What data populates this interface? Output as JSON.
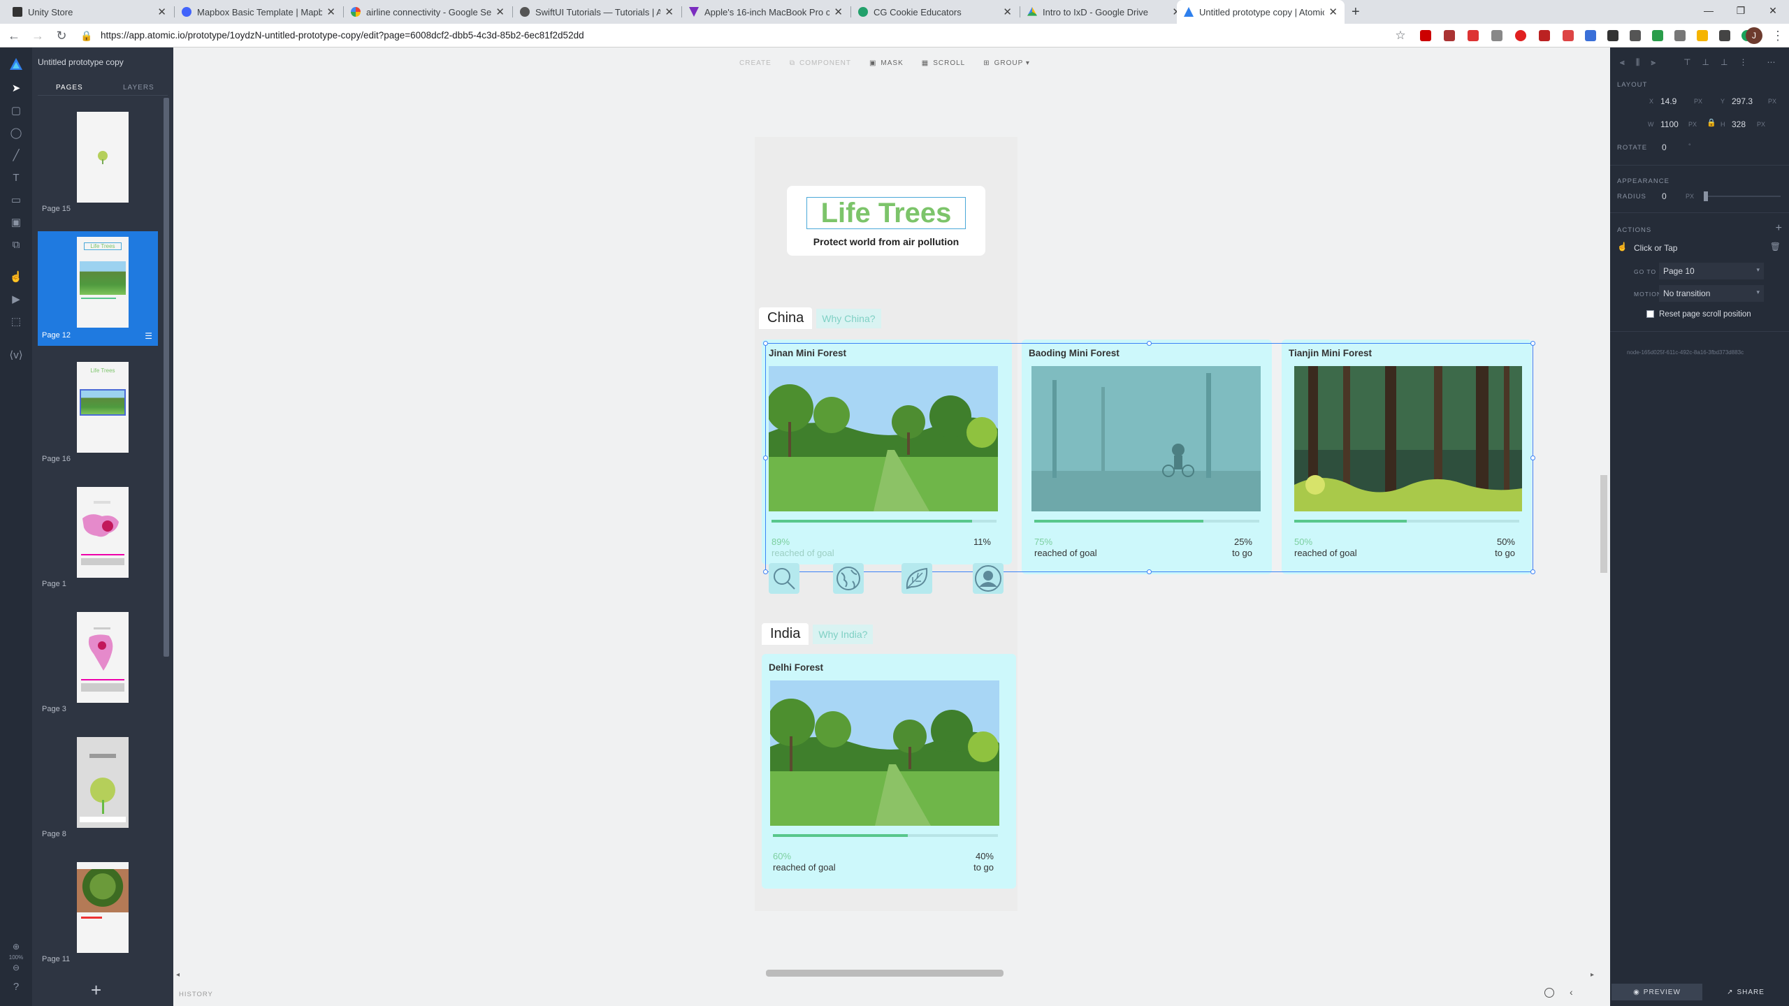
{
  "browser": {
    "tabs": [
      {
        "title": "Unity Store",
        "color": "#333333"
      },
      {
        "title": "Mapbox Basic Template | Mapbo",
        "color": "#4264fb"
      },
      {
        "title": "airline connectivity - Google Sea",
        "color": "#4285f4"
      },
      {
        "title": "SwiftUI Tutorials — Tutorials | Ap",
        "color": "#555555"
      },
      {
        "title": "Apple's 16-inch MacBook Pro co",
        "color": "#7b2cbf"
      },
      {
        "title": "CG Cookie Educators",
        "color": "#22a06b"
      },
      {
        "title": "Intro to IxD - Google Drive",
        "color": "#1a73e8"
      },
      {
        "title": "Untitled prototype copy | Atomic",
        "color": "#2f80ed"
      }
    ],
    "url": "https://app.atomic.io/prototype/1oydzN-untitled-prototype-copy/edit?page=6008dcf2-dbb5-4c3d-85b2-6ec81f2d52dd",
    "new_tab_label": "+",
    "avatar": "J"
  },
  "left_panel": {
    "project_title": "Untitled prototype copy",
    "tabs": {
      "pages": "PAGES",
      "layers": "LAYERS"
    },
    "pages": [
      {
        "name": "Page 15"
      },
      {
        "name": "Page 12",
        "selected": true
      },
      {
        "name": "Page 16"
      },
      {
        "name": "Page 1"
      },
      {
        "name": "Page 3"
      },
      {
        "name": "Page 8"
      },
      {
        "name": "Page 11"
      }
    ],
    "add_label": "+",
    "zoom_label": "100%"
  },
  "toolbar": {
    "create": "CREATE",
    "component": "COMPONENT",
    "mask": "MASK",
    "scroll": "SCROLL",
    "group": "GROUP ▾"
  },
  "app": {
    "brand": "Life Trees",
    "tagline": "Protect world from air pollution",
    "sections": [
      {
        "region": "China",
        "why": "Why China?",
        "forests": [
          {
            "name": "Jinan Mini Forest",
            "progress": 0.89,
            "reached_pct": "89%",
            "reached_label": "reached of goal",
            "togo_pct": "11%",
            "togo_label": ""
          },
          {
            "name": "Baoding Mini Forest",
            "progress": 0.75,
            "reached_pct": "75%",
            "reached_label": "reached of goal",
            "togo_pct": "25%",
            "togo_label": "to go"
          },
          {
            "name": "Tianjin Mini Forest",
            "progress": 0.5,
            "reached_pct": "50%",
            "reached_label": "reached of goal",
            "togo_pct": "50%",
            "togo_label": "to go"
          }
        ]
      },
      {
        "region": "India",
        "why": "Why India?",
        "forests": [
          {
            "name": "Delhi Forest",
            "progress": 0.6,
            "reached_pct": "60%",
            "reached_label": "reached of goal",
            "togo_pct": "40%",
            "togo_label": "to go"
          }
        ]
      }
    ],
    "nav_icons": [
      "search-icon",
      "globe-icon",
      "leaf-icon",
      "profile-icon"
    ]
  },
  "bottom": {
    "history": "HISTORY"
  },
  "inspector": {
    "layout_label": "LAYOUT",
    "x_label": "X",
    "x": "14.9",
    "y_label": "Y",
    "y": "297.3",
    "w_label": "W",
    "w": "1100",
    "h_label": "H",
    "h": "328",
    "unit": "PX",
    "rotate_label": "ROTATE",
    "rotate": "0",
    "deg": "°",
    "appearance_label": "APPEARANCE",
    "radius_label": "RADIUS",
    "radius": "0",
    "actions_label": "ACTIONS",
    "trigger": "Click or Tap",
    "goto_label": "GO TO",
    "goto": "Page 10",
    "motion_label": "MOTION",
    "motion": "No transition",
    "reset_scroll": "Reset page scroll position",
    "node_id": "node-165d025f-611c-492c-8a16-3fbd373d883c",
    "preview": "PREVIEW",
    "share": "SHARE"
  }
}
